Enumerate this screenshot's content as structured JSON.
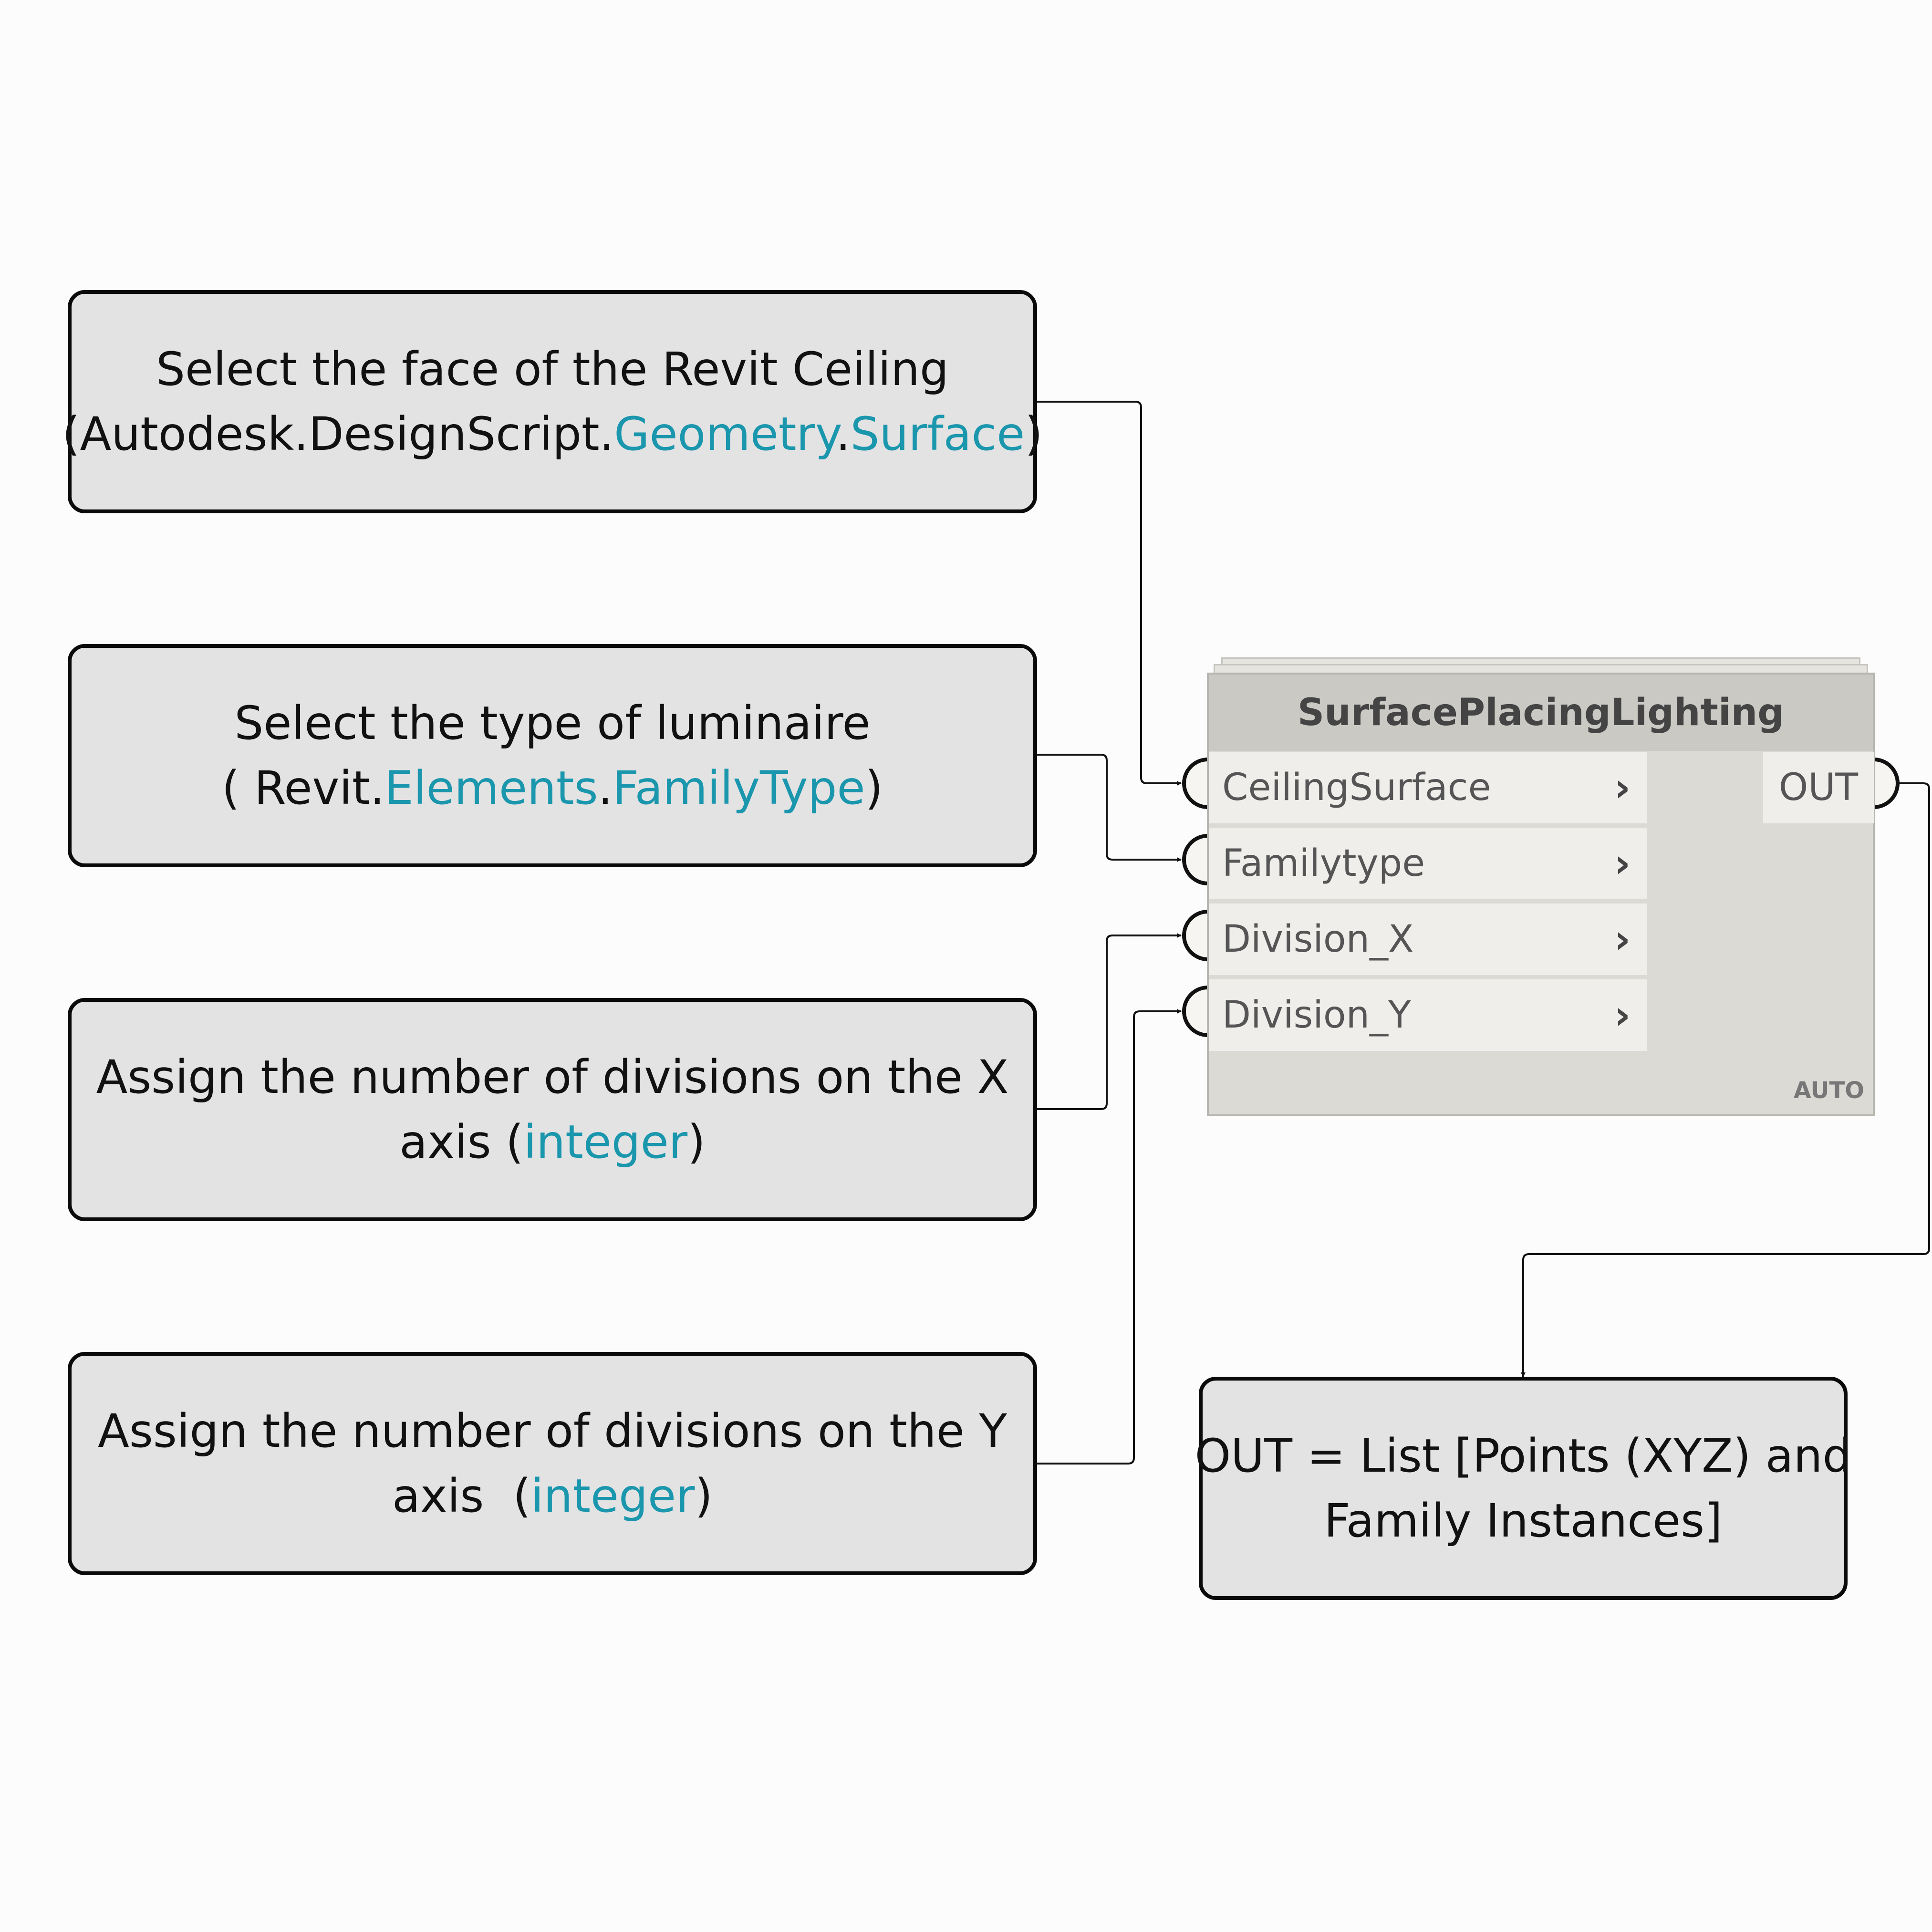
{
  "callouts": [
    {
      "lines": [
        [
          {
            "t": "Select the face of the Revit Ceiling"
          }
        ],
        [
          {
            "t": "(Autodesk.DesignScript."
          },
          {
            "t": "Geometry",
            "accent": true
          },
          {
            "t": "."
          },
          {
            "t": "Surface",
            "accent": true
          },
          {
            "t": ")"
          }
        ]
      ]
    },
    {
      "lines": [
        [
          {
            "t": "Select the type of luminaire"
          }
        ],
        [
          {
            "t": "( Revit."
          },
          {
            "t": "Elements",
            "accent": true
          },
          {
            "t": "."
          },
          {
            "t": "FamilyType",
            "accent": true
          },
          {
            "t": ")"
          }
        ]
      ]
    },
    {
      "lines": [
        [
          {
            "t": "Assign the number of divisions on the X"
          }
        ],
        [
          {
            "t": "axis ("
          },
          {
            "t": "integer",
            "accent": true
          },
          {
            "t": ")"
          }
        ]
      ]
    },
    {
      "lines": [
        [
          {
            "t": "Assign the number of divisions on the Y"
          }
        ],
        [
          {
            "t": "axis  ("
          },
          {
            "t": "integer",
            "accent": true
          },
          {
            "t": ")"
          }
        ]
      ]
    }
  ],
  "output_callout": {
    "lines": [
      [
        {
          "t": "OUT = List [Points (XYZ) and"
        }
      ],
      [
        {
          "t": "Family Instances]"
        }
      ]
    ]
  },
  "node": {
    "title": "SurfacePlacingLighting",
    "inputs": [
      "CeilingSurface",
      "Familytype",
      "Division_X",
      "Division_Y"
    ],
    "output": "OUT",
    "lacing": "AUTO",
    "chevron": "›"
  },
  "colors": {
    "accent": "#1a96ad",
    "callout_fill": "#e3e3e3",
    "callout_border": "#0a0a0a",
    "wire": "#111111"
  }
}
